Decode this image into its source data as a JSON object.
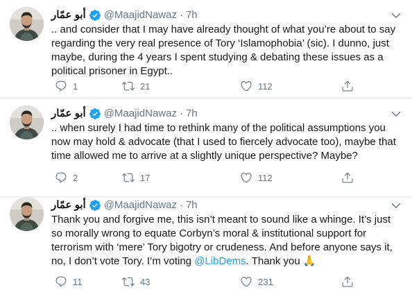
{
  "colors": {
    "accent": "#1da1f2",
    "muted": "#657786",
    "text": "#14171a",
    "border": "#e6ecf0"
  },
  "tweets": [
    {
      "name": "أبو عمّار",
      "handle": "@MaajidNawaz",
      "dot": "·",
      "time": "7h",
      "text": "..  and consider that I may have already thought of what you’re about to say regarding the very real presence of Tory ‘Islamophobia’ (sic). I dunno, just maybe, during the 4 years I spent studying & debating these issues as a political prisoner in Egypt..",
      "replies": "1",
      "retweets": "21",
      "likes": "112"
    },
    {
      "name": "أبو عمّار",
      "handle": "@MaajidNawaz",
      "dot": "·",
      "time": "7h",
      "text": ".. when surely I had time to rethink many of the political assumptions you now may hold & advocate (that I used to fiercely advocate too), maybe that time allowed me to arrive at a slightly unique perspective? Maybe?",
      "replies": "2",
      "retweets": "17",
      "likes": "112"
    },
    {
      "name": "أبو عمّار",
      "handle": "@MaajidNawaz",
      "dot": "·",
      "time": "7h",
      "text_before_link": "Thank you and forgive me, this isn’t meant to sound like a whinge. It’s just so morally wrong to equate Corbyn’s moral & institutional support for terrorism with ‘mere’ Tory bigotry or crudeness. And before anyone says it, no, I don’t vote Tory. I’m voting ",
      "link": "@LibDems",
      "text_after_link": ". Thank you 🙏",
      "replies": "11",
      "retweets": "43",
      "likes": "231"
    }
  ],
  "icons": {
    "avatar": "profile-photo",
    "verified": "verified-badge-icon",
    "caret": "chevron-down-icon",
    "reply": "reply-icon",
    "retweet": "retweet-icon",
    "like": "heart-icon",
    "share": "share-icon"
  }
}
